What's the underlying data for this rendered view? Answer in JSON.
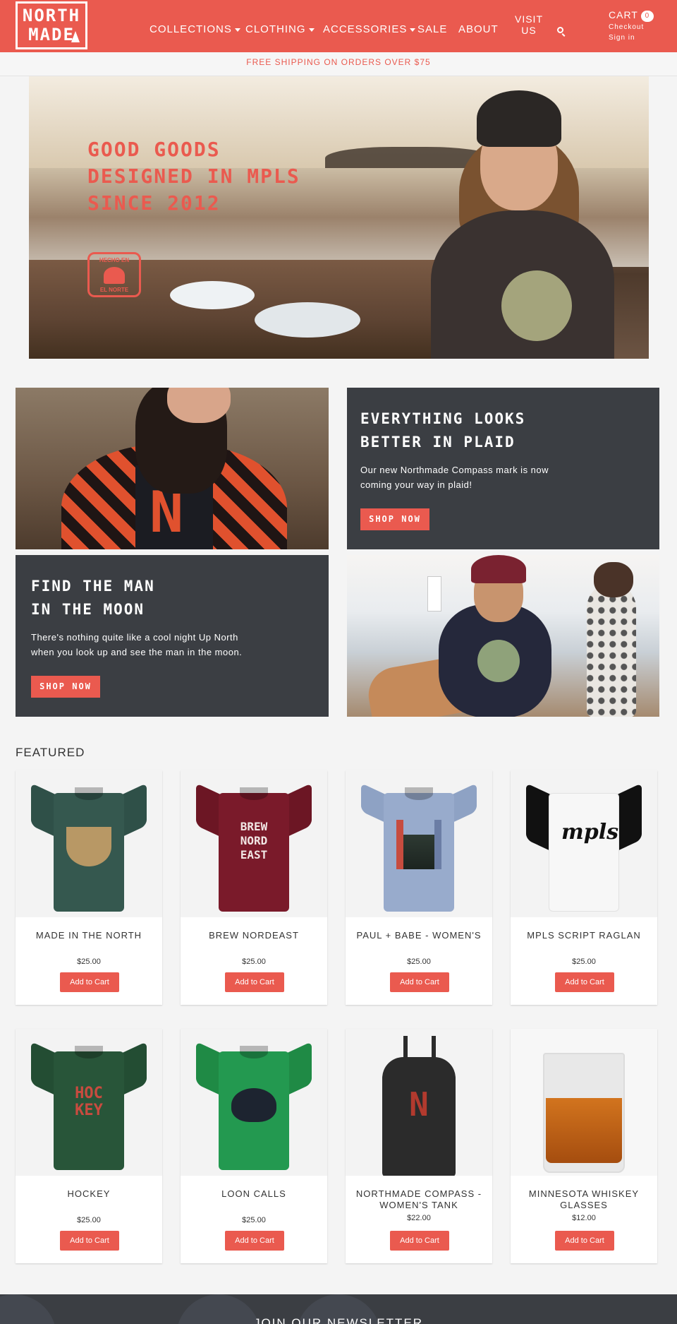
{
  "header": {
    "logo_line1": "NORTH",
    "logo_line2": "MADE",
    "nav": [
      "COLLECTIONS",
      "CLOTHING",
      "ACCESSORIES",
      "SALE",
      "ABOUT"
    ],
    "visit_line1": "VISIT",
    "visit_line2": "US",
    "cart_label": "CART",
    "cart_count": "0",
    "checkout": "Checkout",
    "signin": "Sign in"
  },
  "shipping": "FREE SHIPPING ON ORDERS OVER $75",
  "hero": {
    "line1": "GOOD GOODS",
    "line2": "DESIGNED IN MPLS",
    "line3": "SINCE 2012",
    "badge_top": "HECHO EN",
    "badge_bottom": "EL NORTE"
  },
  "promos": {
    "plaid": {
      "title_line1": "EVERYTHING LOOKS",
      "title_line2": "BETTER IN PLAID",
      "text_line1": "Our new Northmade Compass mark is now",
      "text_line2": "coming your way in plaid!",
      "button": "SHOP NOW"
    },
    "moon": {
      "title_line1": "FIND THE MAN",
      "title_line2": "IN THE MOON",
      "text_line1": "There's nothing quite like a cool night Up North",
      "text_line2": "when you look up and see the man in the moon.",
      "button": "SHOP NOW"
    }
  },
  "featured": {
    "title": "FEATURED",
    "add_to_cart": "Add to Cart",
    "products": [
      {
        "name": "MADE IN THE NORTH",
        "price": "$25.00"
      },
      {
        "name": "BREW NORDEAST",
        "price": "$25.00"
      },
      {
        "name": "PAUL + BABE - WOMEN'S",
        "price": "$25.00"
      },
      {
        "name": "MPLS SCRIPT RAGLAN",
        "price": "$25.00"
      },
      {
        "name": "HOCKEY",
        "price": "$25.00"
      },
      {
        "name": "LOON CALLS",
        "price": "$25.00"
      },
      {
        "name_line1": "NORTHMADE COMPASS -",
        "name_line2": "WOMEN'S TANK",
        "price": "$22.00"
      },
      {
        "name_line1": "MINNESOTA WHISKEY",
        "name_line2": "GLASSES",
        "price": "$12.00"
      }
    ],
    "prints": {
      "brew_1": "BREW",
      "brew_2": "NORD",
      "brew_3": "EAST",
      "mpls": "mpls",
      "hockey_1": "HOC",
      "hockey_2": "KEY",
      "compass": "N"
    }
  },
  "footer": {
    "title": "JOIN OUR NEWSLETTER"
  },
  "colors": {
    "brand": "#ea5a4f",
    "dark": "#3b3e43"
  }
}
